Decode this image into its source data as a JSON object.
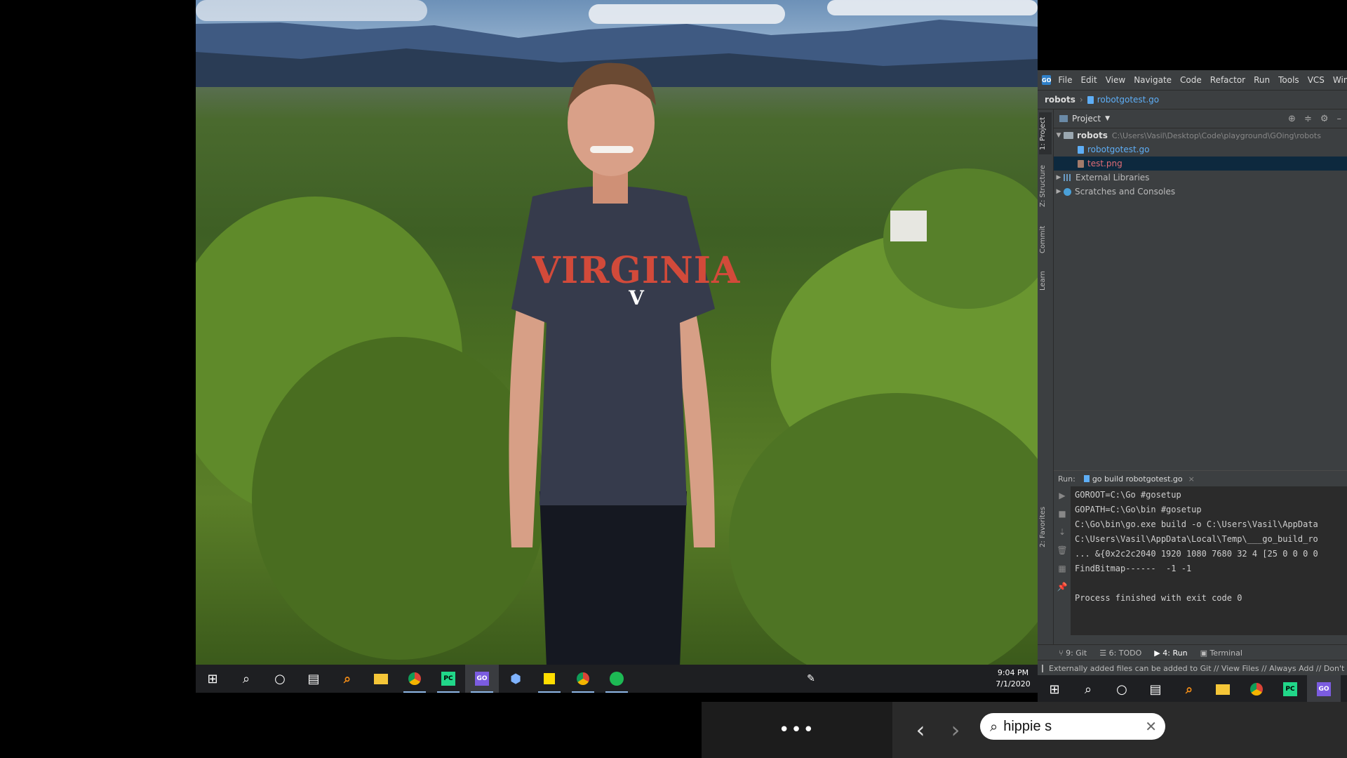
{
  "photo": {
    "shirt_text": "VIRGINIA",
    "shirt_logo": "V"
  },
  "inner_taskbar": {
    "clock_time": "9:04 PM",
    "clock_date": "7/1/2020",
    "icons": [
      "windows-start-icon",
      "search-icon",
      "cortana-icon",
      "task-view-icon",
      "search-app-icon",
      "file-explorer-icon",
      "chrome-icon",
      "pycharm-icon",
      "goland-icon",
      "virtualbox-icon",
      "sticky-notes-icon",
      "chrome-icon",
      "spotify-icon"
    ]
  },
  "ide": {
    "logo": "GO",
    "menu": [
      "File",
      "Edit",
      "View",
      "Navigate",
      "Code",
      "Refactor",
      "Run",
      "Tools",
      "VCS",
      "Window"
    ],
    "breadcrumb": {
      "root": "robots",
      "file": "robotgotest.go"
    },
    "side_tabs": [
      "1: Project",
      "Z: Structure",
      "Commit",
      "Learn",
      "2: Favorites"
    ],
    "project_panel": {
      "title": "Project",
      "root_name": "robots",
      "root_path": "C:\\Users\\Vasil\\Desktop\\Code\\playground\\GOing\\robots",
      "files": [
        "robotgotest.go",
        "test.png"
      ],
      "external": "External Libraries",
      "scratches": "Scratches and Consoles"
    },
    "run_panel": {
      "label": "Run:",
      "tab": "go build robotgotest.go",
      "console": [
        "GOROOT=C:\\Go #gosetup",
        "GOPATH=C:\\Go\\bin #gosetup",
        "C:\\Go\\bin\\go.exe build -o C:\\Users\\Vasil\\AppData",
        "C:\\Users\\Vasil\\AppData\\Local\\Temp\\___go_build_ro",
        "... &{0x2c2c2040 1920 1080 7680 32 4 [25 0 0 0 0",
        "FindBitmap------  -1 -1",
        "",
        "Process finished with exit code 0"
      ]
    },
    "bottom_tabs": [
      "9: Git",
      "6: TODO",
      "4: Run",
      "Terminal"
    ],
    "status": "Externally added files can be added to Git // View Files // Always Add // Don't A"
  },
  "right_taskbar": {
    "icons": [
      "windows-start-icon",
      "search-icon",
      "cortana-icon",
      "task-view-icon",
      "search-app-icon",
      "file-explorer-icon",
      "chrome-icon",
      "pycharm-icon",
      "goland-icon"
    ]
  },
  "bottom_bar": {
    "more_label": "•••",
    "back": "‹",
    "forward": "›",
    "search_value": "hippie s"
  }
}
